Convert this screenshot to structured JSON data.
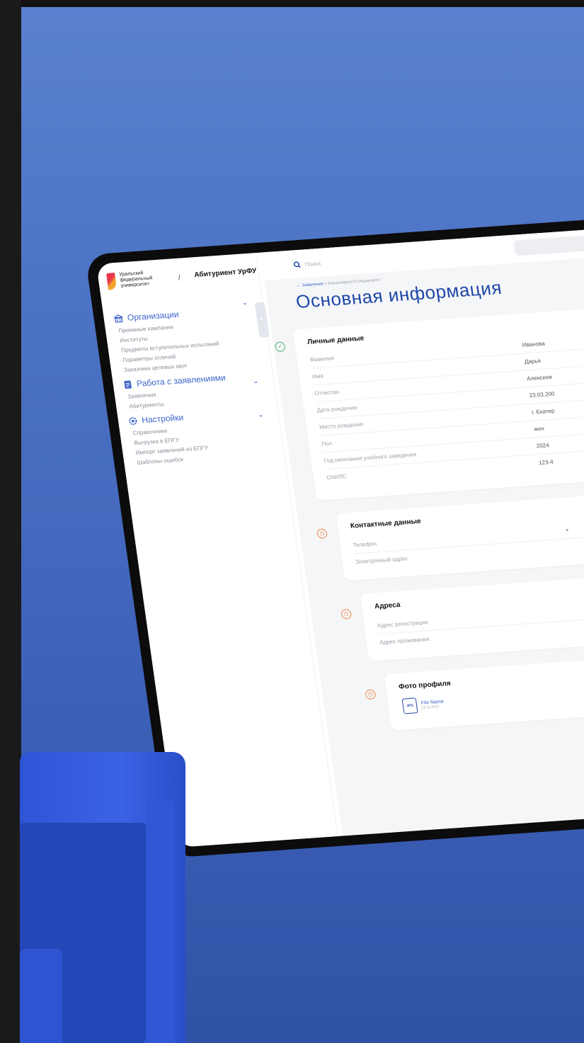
{
  "app": {
    "logo_text": "Уральский федеральный университет",
    "separator": "/",
    "name": "Абитуриент УрФУ"
  },
  "search": {
    "placeholder": "Поиск"
  },
  "sidebar": {
    "sections": [
      {
        "label": "Организации",
        "icon": "building-icon",
        "items": [
          "Приемные кампании",
          "Институты",
          "Предметы вступительных испытаний",
          "Параметры отличий",
          "Заказчики целевых квот"
        ]
      },
      {
        "label": "Работа с заявлениями",
        "icon": "document-icon",
        "items": [
          "Заявления",
          "Абитуриенты"
        ]
      },
      {
        "label": "Настройки",
        "icon": "gear-icon",
        "items": [
          "Справочники",
          "Выгрузка в ЕПГУ",
          "Импорт заявлений из ЕПГУ",
          "Шаблоны ошибок"
        ]
      }
    ]
  },
  "breadcrumb": {
    "back": "← Заявления",
    "separator": ">",
    "current": "Бакалавриат/Специалитет"
  },
  "page_title": "Основная информация",
  "personal": {
    "title": "Личные данные",
    "status": "complete",
    "rows": [
      {
        "label": "Фамилия",
        "value": "Иванова"
      },
      {
        "label": "Имя",
        "value": "Дарья"
      },
      {
        "label": "Отчество",
        "value": "Алексеев"
      },
      {
        "label": "Дата рождения",
        "value": "23.03.200"
      },
      {
        "label": "Место рождения",
        "value": "г. Екатер"
      },
      {
        "label": "Пол",
        "value": "жен"
      },
      {
        "label": "Год окончания учебного заведения",
        "value": "2024"
      },
      {
        "label": "СНИЛС",
        "value": "123-4"
      }
    ]
  },
  "contacts": {
    "title": "Контактные данные",
    "status": "pending",
    "rows": [
      {
        "label": "Телефон",
        "value": "+"
      },
      {
        "label": "Электронный адрес",
        "value": ""
      }
    ]
  },
  "addresses": {
    "title": "Адреса",
    "status": "pending",
    "rows": [
      {
        "label": "Адрес регистрации",
        "value": ""
      },
      {
        "label": "Адрес проживания",
        "value": ""
      }
    ]
  },
  "photo": {
    "title": "Фото профиля",
    "status": "pending",
    "file_name": "File Name",
    "file_type": "JPG",
    "file_date": "12.11.2023"
  },
  "colors": {
    "accent": "#3d64c9",
    "title": "#1f48a8",
    "ok": "#45b36b",
    "pending": "#f0884a",
    "background": "#4a70c3"
  }
}
